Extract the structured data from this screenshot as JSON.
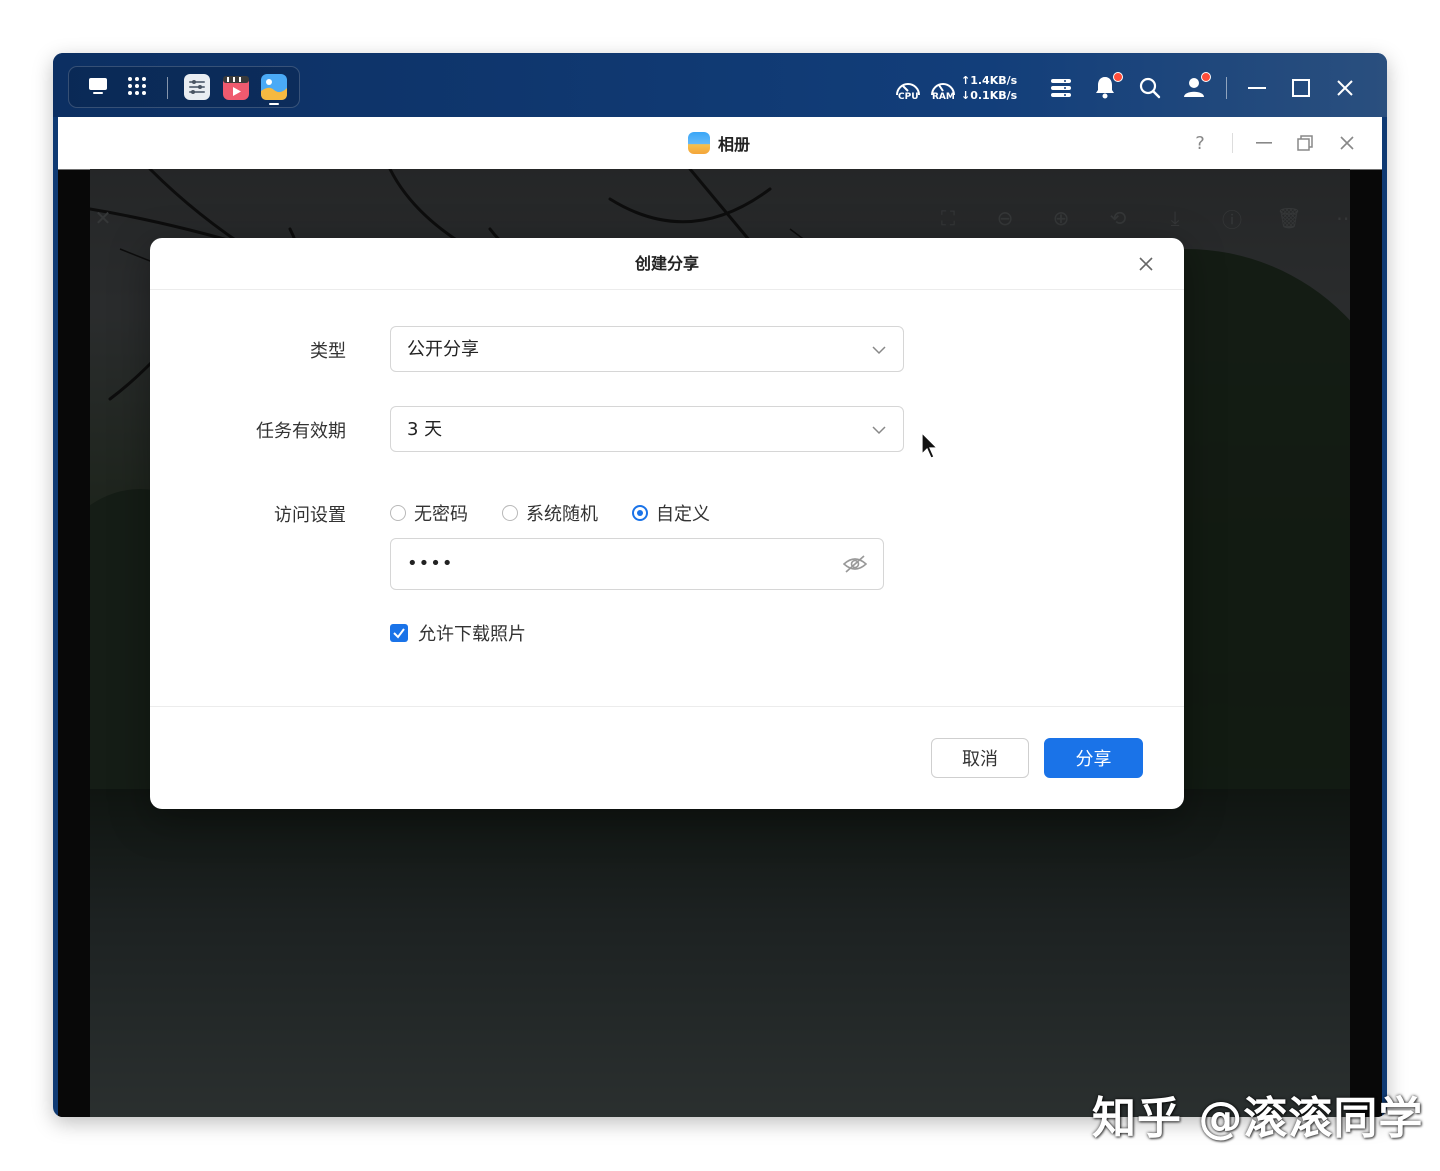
{
  "taskbar": {
    "cpu_label": "CPU",
    "ram_label": "RAM",
    "upload_speed": "↑1.4KB/s",
    "download_speed": "↓0.1KB/s"
  },
  "window": {
    "title": "相册",
    "help_label": "?"
  },
  "dialog": {
    "title": "创建分享",
    "type_label": "类型",
    "type_value": "公开分享",
    "validity_label": "任务有效期",
    "validity_value": "3 天",
    "access_label": "访问设置",
    "access_options": [
      "无密码",
      "系统随机",
      "自定义"
    ],
    "access_selected": "自定义",
    "password_value": "••••",
    "allow_download_label": "允许下载照片",
    "allow_download_checked": true,
    "cancel_label": "取消",
    "share_label": "分享"
  },
  "watermark": "知乎 @滚滚同学",
  "colors": {
    "accent": "#1a73e8",
    "taskbar": "#123e7a",
    "notify_dot": "#ff4d3a"
  }
}
